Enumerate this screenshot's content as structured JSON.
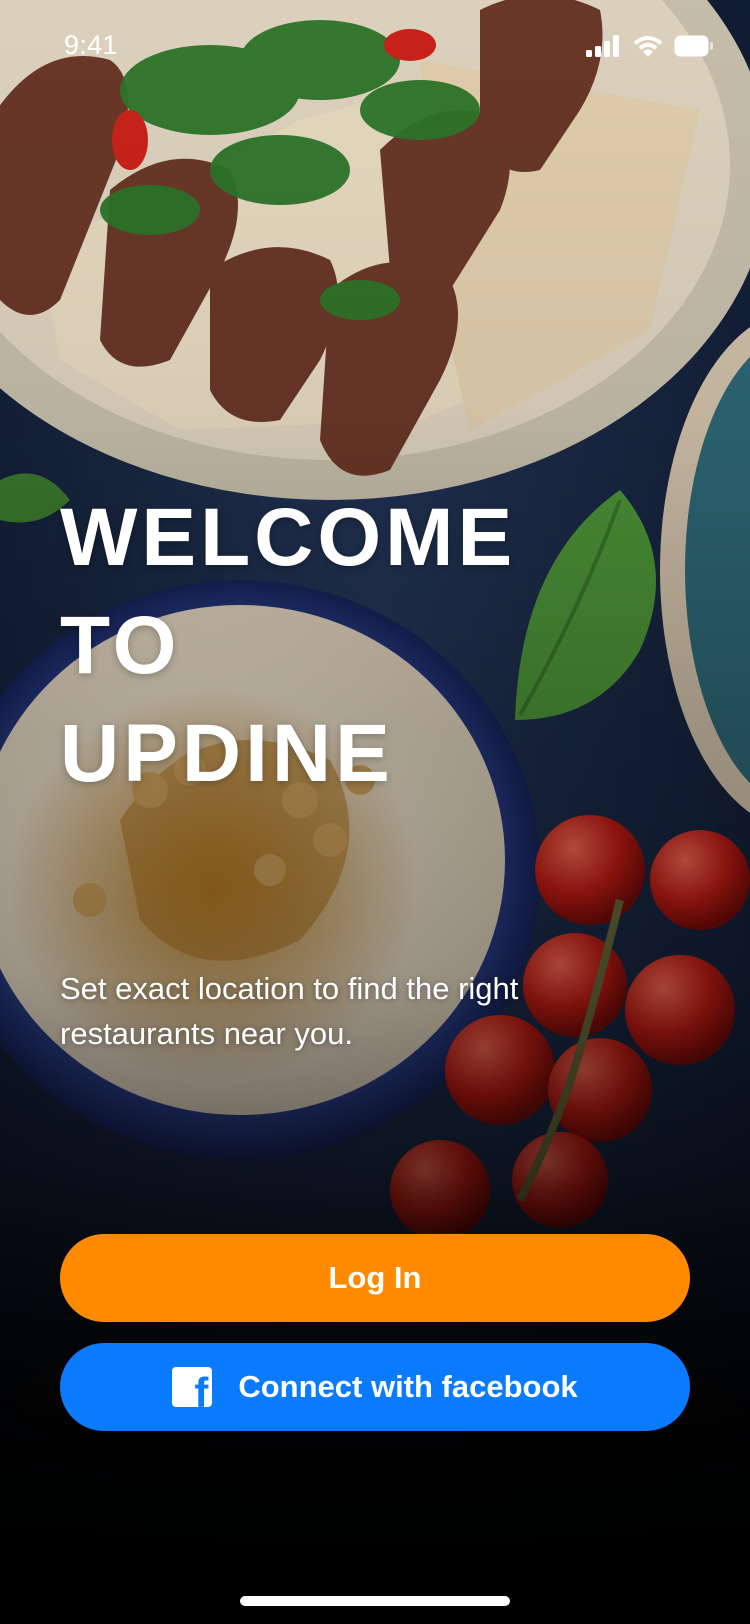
{
  "status_bar": {
    "time": "9:41",
    "icons": [
      "cellular-signal-icon",
      "wifi-icon",
      "battery-icon"
    ]
  },
  "hero": {
    "headline_lines": [
      "WELCOME",
      "TO",
      "UPDINE"
    ],
    "subtitle": "Set exact location to find the right restaurants near you."
  },
  "actions": {
    "login_label": "Log In",
    "facebook_label": "Connect with facebook",
    "facebook_icon": "facebook-icon"
  },
  "colors": {
    "login": "#ff8a00",
    "facebook": "#0a7bff",
    "text": "#ffffff"
  }
}
